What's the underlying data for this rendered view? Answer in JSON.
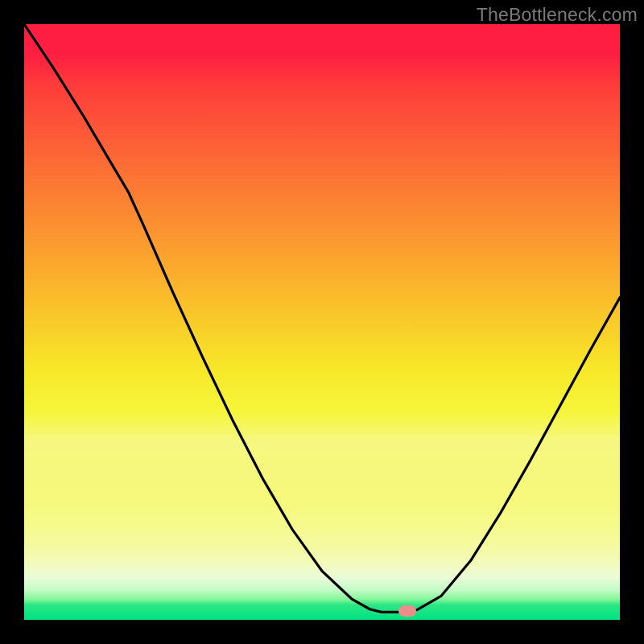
{
  "watermark": "TheBottleneck.com",
  "dot": {
    "x_frac": 0.643,
    "y_frac": 0.985
  },
  "chart_data": {
    "type": "line",
    "title": "",
    "xlabel": "",
    "ylabel": "",
    "xlim": [
      0,
      1
    ],
    "ylim": [
      0,
      1
    ],
    "grid": false,
    "legend": false,
    "note": "Axes unlabeled in source image; x and y are normalized fractions of the plot area (origin top-left). Curve descends from top-left, reaches a flat minimum near x≈0.60–0.65 at the bottom, then rises toward the right edge.",
    "series": [
      {
        "name": "curve",
        "x": [
          0.0,
          0.05,
          0.1,
          0.15,
          0.175,
          0.2,
          0.25,
          0.3,
          0.35,
          0.4,
          0.45,
          0.5,
          0.55,
          0.58,
          0.6,
          0.63,
          0.66,
          0.7,
          0.75,
          0.8,
          0.85,
          0.9,
          0.95,
          1.0
        ],
        "y": [
          0.0,
          0.075,
          0.155,
          0.24,
          0.282,
          0.337,
          0.451,
          0.56,
          0.665,
          0.762,
          0.848,
          0.918,
          0.965,
          0.982,
          0.987,
          0.987,
          0.983,
          0.96,
          0.9,
          0.82,
          0.732,
          0.64,
          0.548,
          0.459
        ]
      }
    ],
    "marker": {
      "shape": "rounded-rect",
      "color": "#E98E88",
      "x_frac": 0.643,
      "y_frac": 0.985
    },
    "background_gradient_stops": [
      {
        "pos": 0.0,
        "color": "#FE1E41"
      },
      {
        "pos": 0.5,
        "color": "#F9CB29"
      },
      {
        "pos": 0.8,
        "color": "#F6F97B"
      },
      {
        "pos": 0.97,
        "color": "#2BE784"
      },
      {
        "pos": 1.0,
        "color": "#00E182"
      }
    ]
  }
}
